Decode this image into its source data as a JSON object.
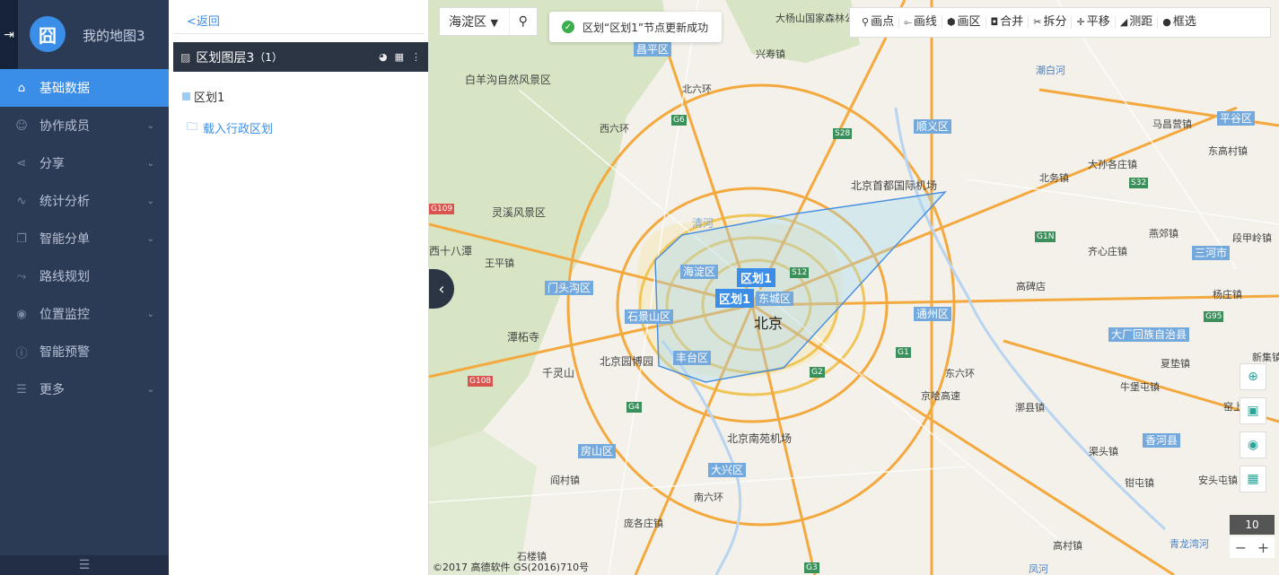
{
  "app": {
    "title": "我的地图3"
  },
  "sidebar": {
    "items": [
      {
        "label": "基础数据",
        "icon": "home-icon",
        "active": true,
        "expandable": false
      },
      {
        "label": "协作成员",
        "icon": "user-icon",
        "active": false,
        "expandable": true
      },
      {
        "label": "分享",
        "icon": "share-icon",
        "active": false,
        "expandable": true
      },
      {
        "label": "统计分析",
        "icon": "chart-icon",
        "active": false,
        "expandable": true
      },
      {
        "label": "智能分单",
        "icon": "copy-icon",
        "active": false,
        "expandable": true
      },
      {
        "label": "路线规划",
        "icon": "route-icon",
        "active": false,
        "expandable": false
      },
      {
        "label": "位置监控",
        "icon": "location-icon",
        "active": false,
        "expandable": true
      },
      {
        "label": "智能预警",
        "icon": "info-icon",
        "active": false,
        "expandable": false
      },
      {
        "label": "更多",
        "icon": "list-icon",
        "active": false,
        "expandable": true
      }
    ]
  },
  "panel": {
    "back_label": "<返回",
    "layer_title": "区划图层3",
    "layer_count": "（1）",
    "zone_name": "区划1",
    "load_admin_label": "载入行政区划"
  },
  "map": {
    "district_select": "海淀区",
    "toast": "区划“区划1”节点更新成功",
    "tools": [
      {
        "label": "画点",
        "icon": "pin-icon"
      },
      {
        "label": "画线",
        "icon": "line-icon"
      },
      {
        "label": "画区",
        "icon": "polygon-icon"
      },
      {
        "label": "合并",
        "icon": "merge-icon"
      },
      {
        "label": "拆分",
        "icon": "split-icon"
      },
      {
        "label": "平移",
        "icon": "move-icon"
      },
      {
        "label": "测距",
        "icon": "ruler-icon"
      },
      {
        "label": "框选",
        "icon": "select-icon"
      }
    ],
    "zoom_level": "10",
    "copyright": "©2017 高德软件 GS(2016)710号",
    "zone_labels": [
      "区划1",
      "区划1"
    ],
    "district_labels": [
      "昌平区",
      "顺义区",
      "平谷区",
      "门头沟区",
      "海淀区",
      "东城区",
      "石景山区",
      "通州区",
      "丰台区",
      "房山区",
      "大兴区",
      "三河市",
      "大厂回族自治县",
      "香河县"
    ],
    "place_labels": [
      "白羊沟自然风景区",
      "北京首都国际机场",
      "灵溪风景区",
      "西十八潭",
      "王平镇",
      "潭柘寺",
      "千灵山",
      "北京园博园",
      "北京",
      "北京南苑机场",
      "大杨山国家森林公园",
      "北六环",
      "西六环",
      "兴寿镇",
      "马昌营镇",
      "东高村镇",
      "大孙各庄镇",
      "北务镇",
      "齐心庄镇",
      "燕郊镇",
      "高碑店",
      "杨庄镇",
      "夏垫镇",
      "牛堡屯镇",
      "漷县镇",
      "窑上镇",
      "渠头镇",
      "安头屯镇",
      "钳屯镇",
      "高村镇",
      "南六环",
      "庞各庄镇",
      "石楼镇",
      "阎村镇",
      "清河",
      "东六环",
      "京哈高速",
      "青龙湾河",
      "凤河",
      "潮白河",
      "段甲岭镇",
      "新集镇"
    ],
    "highway_labels": [
      "G6",
      "S28",
      "G109",
      "G108",
      "G4",
      "S12",
      "G1",
      "G2",
      "G95",
      "G1N",
      "S32",
      "G3"
    ]
  },
  "colors": {
    "sidebar_bg": "#2b3a55",
    "accent": "#3b8ee8",
    "layer_head_bg": "#2b3443",
    "success": "#3aae4a",
    "zone_stroke": "#4a90e2"
  }
}
